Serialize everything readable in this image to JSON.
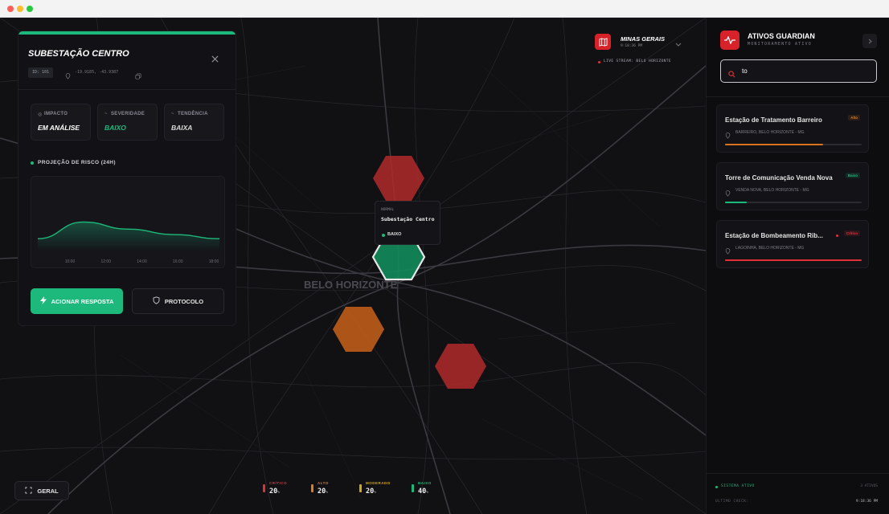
{
  "window": {
    "dots": [
      "#ff5f57",
      "#febc2e",
      "#28c840"
    ]
  },
  "map": {
    "city_label": "BELO HORIZONTE",
    "region": {
      "name": "MINAS GERAIS",
      "time": "9:18:36 PM"
    },
    "live_stream": "LIVE STREAM: BELO HORIZONTE",
    "popup": {
      "status": "NORMAL",
      "name": "Subestação Centro",
      "level": "BAIXO"
    },
    "hexes": [
      {
        "risk": "critical",
        "color": "#b12a2a"
      },
      {
        "risk": "low",
        "color": "#138a5c",
        "selected": true
      },
      {
        "risk": "high",
        "color": "#c9621a"
      },
      {
        "risk": "critical",
        "color": "#b12a2a"
      }
    ],
    "view_button": "GERAL"
  },
  "detail": {
    "title": "SUBESTAÇÃO CENTRO",
    "id_badge": "ID: 101",
    "coords": "-19.9185, -43.9387",
    "metrics": [
      {
        "label": "IMPACTO",
        "value": "EM ANÁLISE",
        "color": "#ffffff"
      },
      {
        "label": "SEVERIDADE",
        "value": "BAIXO",
        "color": "#1db97c"
      },
      {
        "label": "TENDÊNCIA",
        "value": "BAIXA",
        "color": "#d8d8d8"
      }
    ],
    "chart_title": "PROJEÇÃO DE RISCO (24H)",
    "chart_data": {
      "type": "area",
      "x": [
        "10:00",
        "12:00",
        "14:00",
        "16:00",
        "18:00"
      ],
      "values": [
        20,
        48,
        36,
        27,
        20
      ],
      "ylim": [
        0,
        100
      ],
      "grid": false,
      "color": "#1db97c"
    },
    "primary_button": "ACIONAR RESPOSTA",
    "secondary_button": "PROTOCOLO"
  },
  "legend": [
    {
      "name": "CRÍTICO",
      "value": "20",
      "unit": "%",
      "color": "#e0303a"
    },
    {
      "name": "ALTO",
      "value": "20",
      "unit": "%",
      "color": "#e07a22"
    },
    {
      "name": "MODERADO",
      "value": "20",
      "unit": "%",
      "color": "#d4a80f"
    },
    {
      "name": "BAIXO",
      "value": "40",
      "unit": "%",
      "color": "#1db97c"
    }
  ],
  "panel": {
    "title": "ATIVOS GUARDIAN",
    "subtitle": "MONITORAMENTO ATIVO",
    "search_value": "to",
    "assets": [
      {
        "name": "Estação de Tratamento Barreiro",
        "location": "BARREIRO, BELO HORIZONTE - MG",
        "badge": "Alto",
        "badge_color": "#e07a22",
        "level": 0.72,
        "bar_color": "#d9731f"
      },
      {
        "name": "Torre de Comunicação Venda Nova",
        "location": "VENDA NOVA, BELO HORIZONTE - MG",
        "badge": "Baixo",
        "badge_color": "#1db97c",
        "level": 0.16,
        "bar_color": "#1db97c"
      },
      {
        "name": "Estação de Bombeamento Rib...",
        "location": "LAGOINHA, BELO HORIZONTE - MG",
        "badge": "Crítico",
        "badge_color": "#e0303a",
        "level": 1.0,
        "bar_color": "#e0303a"
      }
    ],
    "footer": {
      "system_status": "SISTEMA ATIVO",
      "count": "3 ATIVOS",
      "last_check_label": "ÚLTIMO CHECK:",
      "last_check_time": "9:18:36 PM"
    }
  },
  "colors": {
    "accent": "#1db97c",
    "danger": "#e0303a"
  }
}
